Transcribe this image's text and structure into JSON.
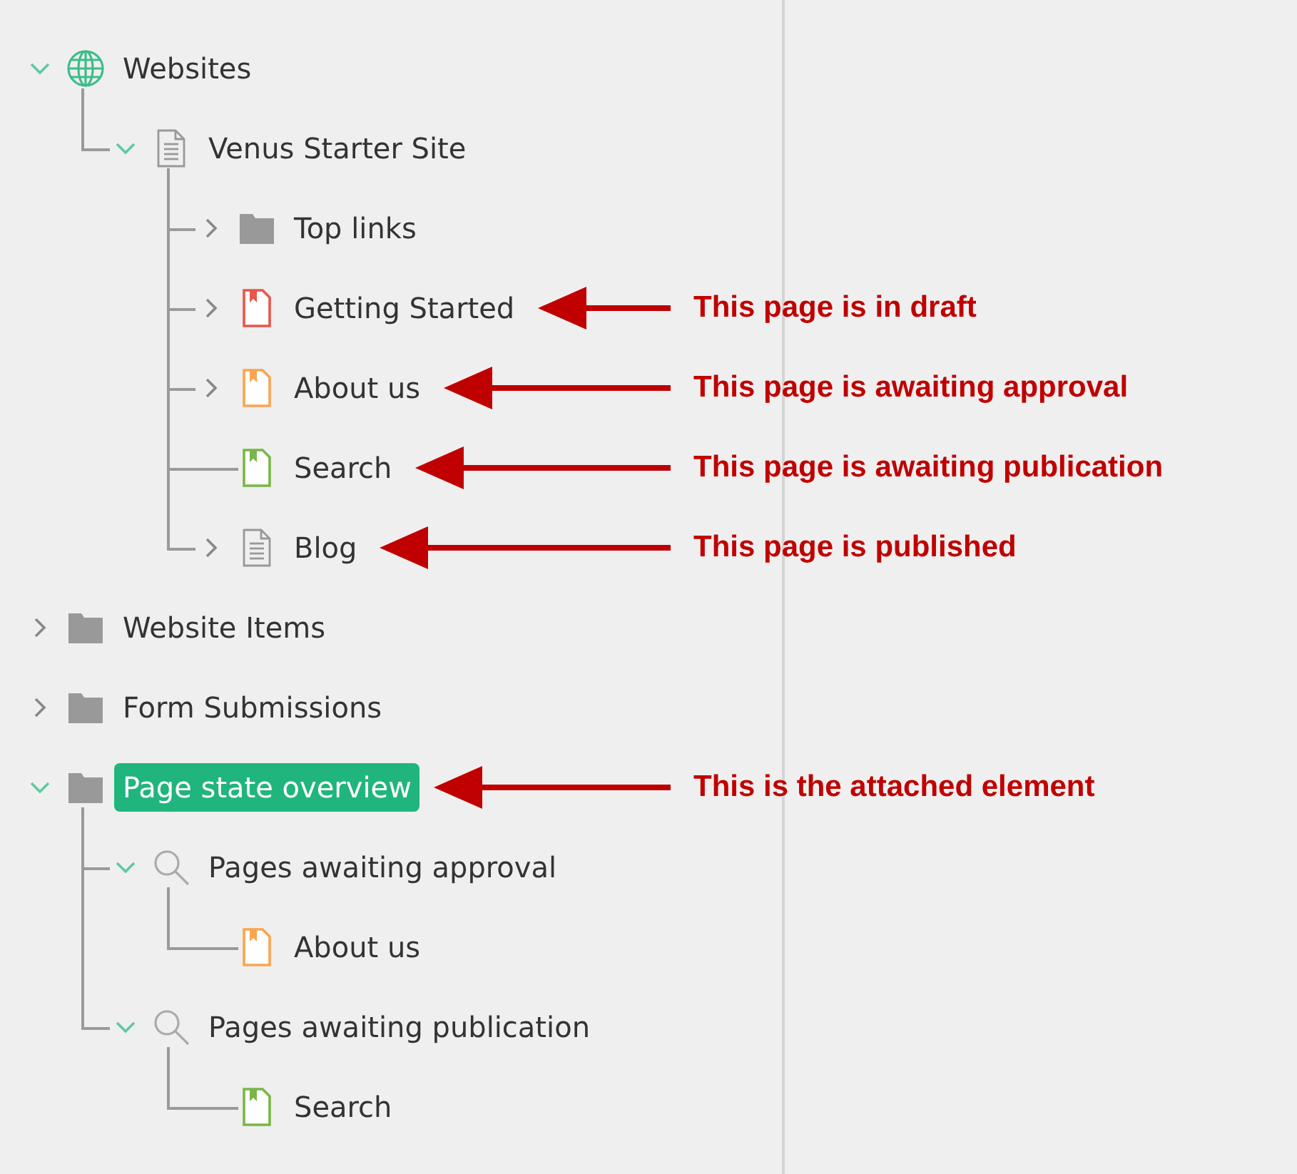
{
  "tree": [
    {
      "label": "Websites",
      "kind": "globe",
      "expanded": true,
      "selected": false,
      "children": [
        {
          "label": "Venus Starter Site",
          "kind": "document",
          "expanded": true,
          "selected": false,
          "children": [
            {
              "label": "Top links",
              "kind": "folder",
              "expanded": false,
              "selected": false
            },
            {
              "label": "Getting Started",
              "kind": "page",
              "color": "#e8574a",
              "expanded": false,
              "selected": false,
              "note": "This page is in draft"
            },
            {
              "label": "About us",
              "kind": "page",
              "color": "#f9a54f",
              "expanded": false,
              "selected": false,
              "note": "This page is awaiting approval"
            },
            {
              "label": "Search",
              "kind": "page",
              "color": "#7ab648",
              "selected": false,
              "note": "This page is awaiting publication"
            },
            {
              "label": "Blog",
              "kind": "document",
              "expanded": false,
              "selected": false,
              "note": "This page is published"
            }
          ]
        }
      ]
    },
    {
      "label": "Website Items",
      "kind": "folder",
      "expanded": false,
      "selected": false
    },
    {
      "label": "Form Submissions",
      "kind": "folder",
      "expanded": false,
      "selected": false
    },
    {
      "label": "Page state overview",
      "kind": "folder",
      "expanded": true,
      "selected": true,
      "note": "This is the attached element",
      "children": [
        {
          "label": "Pages awaiting approval",
          "kind": "search",
          "expanded": true,
          "selected": false,
          "children": [
            {
              "label": "About us",
              "kind": "page",
              "color": "#f9a54f",
              "selected": false
            }
          ]
        },
        {
          "label": "Pages awaiting publication",
          "kind": "search",
          "expanded": true,
          "selected": false,
          "children": [
            {
              "label": "Search",
              "kind": "page",
              "color": "#7ab648",
              "selected": false
            }
          ]
        }
      ]
    }
  ]
}
